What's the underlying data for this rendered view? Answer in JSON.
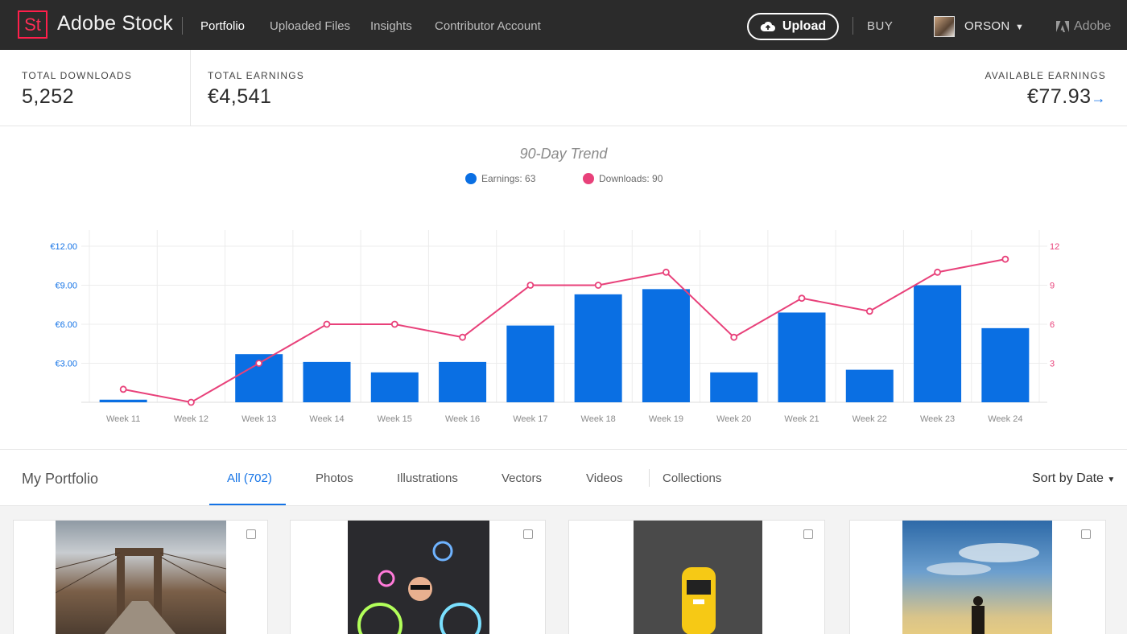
{
  "header": {
    "logo_text": "St",
    "brand": "Adobe Stock",
    "nav": [
      "Portfolio",
      "Uploaded Files",
      "Insights",
      "Contributor Account"
    ],
    "active_nav": "Portfolio",
    "upload_label": "Upload",
    "buy_label": "BUY",
    "user_name": "ORSON",
    "adobe_label": "Adobe"
  },
  "stats": {
    "total_downloads_label": "TOTAL DOWNLOADS",
    "total_downloads_value": "5,252",
    "total_earnings_label": "TOTAL EARNINGS",
    "total_earnings_value": "€4,541",
    "available_earnings_label": "AVAILABLE EARNINGS",
    "available_earnings_value": "€77.93"
  },
  "chart_data": {
    "type": "bar",
    "title": "90-Day Trend",
    "categories": [
      "Week 11",
      "Week 12",
      "Week 13",
      "Week 14",
      "Week 15",
      "Week 16",
      "Week 17",
      "Week 18",
      "Week 19",
      "Week 20",
      "Week 21",
      "Week 22",
      "Week 23",
      "Week 24"
    ],
    "series": [
      {
        "name": "Earnings: 63",
        "kind": "bar",
        "axis": "left",
        "color": "#0a6fe3",
        "values": [
          0.2,
          0,
          3.7,
          3.1,
          2.3,
          3.1,
          5.9,
          8.3,
          8.7,
          2.3,
          6.9,
          2.5,
          9.0,
          5.7
        ]
      },
      {
        "name": "Downloads: 90",
        "kind": "line",
        "axis": "right",
        "color": "#e8417a",
        "values": [
          1,
          0,
          3,
          6,
          6,
          5,
          9,
          9,
          10,
          5,
          8,
          7,
          10,
          11
        ]
      }
    ],
    "y_left": {
      "ticks": [
        "€3.00",
        "€6.00",
        "€9.00",
        "€12.00"
      ],
      "tick_values": [
        3,
        6,
        9,
        12
      ],
      "range": [
        0,
        12
      ]
    },
    "y_right": {
      "ticks": [
        "3",
        "6",
        "9",
        "12"
      ],
      "tick_values": [
        3,
        6,
        9,
        12
      ],
      "range": [
        0,
        12
      ]
    },
    "grid": true,
    "legend_position": "top-center"
  },
  "portfolio": {
    "title": "My Portfolio",
    "tabs": [
      "All (702)",
      "Photos",
      "Illustrations",
      "Vectors",
      "Videos",
      "Collections"
    ],
    "active_tab": "All (702)",
    "sort_label": "Sort by Date"
  },
  "colors": {
    "accent": "#1473e6",
    "earnings": "#0a6fe3",
    "downloads": "#e8417a",
    "logo_red": "#ff1f4b",
    "topbar": "#2b2b2b"
  }
}
